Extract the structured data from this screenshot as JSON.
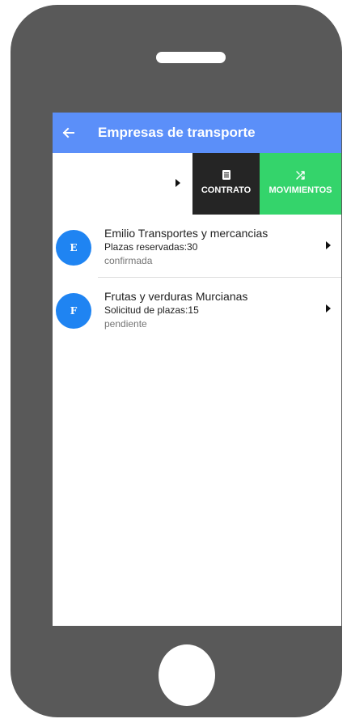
{
  "app_bar": {
    "title": "Empresas de transporte",
    "back_icon": "arrow-back-icon",
    "color": "#5b8ff9"
  },
  "swipe_actions": {
    "contrato": {
      "label": "CONTRATO",
      "icon": "document-icon",
      "color": "#252525"
    },
    "movimientos": {
      "label": "MOVIMIENTOS",
      "icon": "shuffle-icon",
      "color": "#34d46b"
    }
  },
  "companies": [
    {
      "initial": "E",
      "name": "Emilio Transportes y mercancias",
      "detail": "Plazas reservadas:30",
      "status": "confirmada"
    },
    {
      "initial": "F",
      "name": "Frutas y verduras Murcianas",
      "detail": "Solicitud de plazas:15",
      "status": "pendiente"
    }
  ],
  "avatar_color": "#1f84f2"
}
